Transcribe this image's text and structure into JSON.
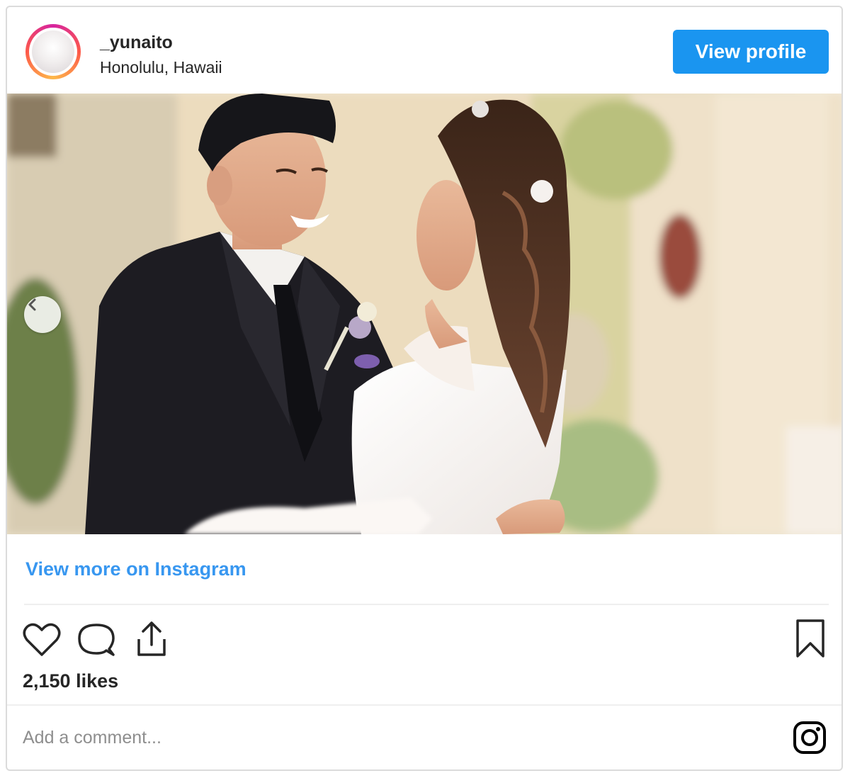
{
  "post": {
    "username": "_yunaito",
    "location": "Honolulu, Hawaii",
    "view_profile_label": "View profile",
    "view_more_label": "View more on Instagram",
    "likes": "2,150 likes",
    "comment_placeholder": "Add a comment..."
  },
  "icons": {
    "like": "heart-icon",
    "comment": "comment-icon",
    "share": "share-icon",
    "save": "bookmark-icon",
    "instagram": "instagram-icon",
    "prev": "chevron-left-icon"
  },
  "colors": {
    "accent": "#1a95f0",
    "link": "#3897f0",
    "text": "#262626",
    "muted": "#8e8e8e",
    "border": "#dbdbdb"
  }
}
